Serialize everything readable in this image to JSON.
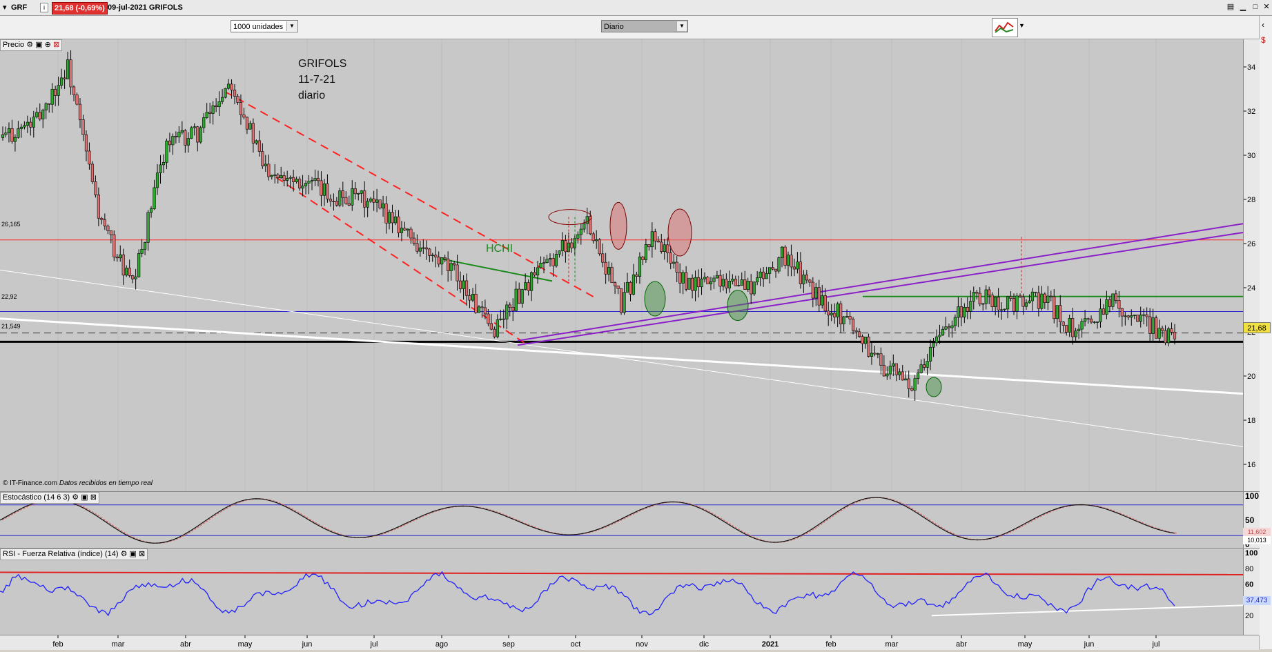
{
  "header": {
    "symbol": "GRF",
    "info_icon": "i",
    "price_change": "21,68 (-0,69%)",
    "date_name": "09-jul-2021 GRIFOLS"
  },
  "toolbar": {
    "units_select": "1000 unidades",
    "period_select": "Diario"
  },
  "panels": {
    "price_title": "Precio",
    "stoch_title": "Estocástico (14 6 3)",
    "rsi_title": "RSI - Fuerza Relativa (índice) (14)",
    "copyright": "© IT-Finance.com",
    "realtime": "Datos recibidos en tiempo real"
  },
  "annotations": {
    "title_lines": [
      "GRIFOLS",
      "11-7-21",
      "diario"
    ],
    "hchi": "HCHI"
  },
  "level_labels": {
    "l1": "26,165",
    "l2": "22,92",
    "l3": "21,549"
  },
  "price_axis": {
    "ticks": [
      "34",
      "32",
      "30",
      "28",
      "26",
      "24",
      "22",
      "20",
      "18",
      "16"
    ],
    "current": "21,68"
  },
  "stoch_axis": {
    "ticks": [
      "100",
      "50",
      "0"
    ],
    "k_value": "11,602",
    "d_value": "10,013"
  },
  "rsi_axis": {
    "ticks": [
      "100",
      "80",
      "60",
      "40",
      "20"
    ],
    "current": "37,473"
  },
  "x_axis": {
    "ticks": [
      "feb",
      "mar",
      "abr",
      "may",
      "jun",
      "jul",
      "ago",
      "sep",
      "oct",
      "nov",
      "dic",
      "2021",
      "feb",
      "mar",
      "abr",
      "may",
      "jun",
      "jul"
    ]
  },
  "colors": {
    "up_candle": "#2fa82f",
    "down_candle": "#e07070",
    "bg": "#c8c8c8",
    "resistance": "#ff2020",
    "purple": "#8a1fc8",
    "green_line": "#1a8a1a",
    "rsi_line": "#2020ff"
  },
  "chart_data": [
    {
      "type": "candlestick",
      "title": "GRIFOLS",
      "ylim": [
        15,
        35
      ],
      "close_path": [
        [
          "feb",
          30.8
        ],
        [
          "feb-mid",
          31.5
        ],
        [
          "mar",
          34.0
        ],
        [
          "mar-mid",
          27.0
        ],
        [
          "mar-end",
          24.0
        ],
        [
          "abr",
          30.5
        ],
        [
          "abr-mid",
          31.0
        ],
        [
          "may",
          33.5
        ],
        [
          "may-mid",
          29.5
        ],
        [
          "jun",
          29.0
        ],
        [
          "jun-mid",
          28.2
        ],
        [
          "jul",
          28.0
        ],
        [
          "jul-mid",
          27.2
        ],
        [
          "ago",
          25.5
        ],
        [
          "ago-mid",
          24.5
        ],
        [
          "sep",
          22.0
        ],
        [
          "sep-mid",
          24.0
        ],
        [
          "oct",
          25.5
        ],
        [
          "oct-mid",
          27.0
        ],
        [
          "nov",
          23.2
        ],
        [
          "nov-mid",
          26.5
        ],
        [
          "dic",
          24.0
        ],
        [
          "dic-mid",
          24.5
        ],
        [
          "2021",
          24.0
        ],
        [
          "ene-end",
          25.5
        ],
        [
          "feb",
          23.6
        ],
        [
          "feb-mid",
          22.5
        ],
        [
          "mar",
          20.5
        ],
        [
          "mar-mid",
          19.5
        ],
        [
          "abr",
          22.5
        ],
        [
          "abr-mid",
          23.6
        ],
        [
          "may",
          23.2
        ],
        [
          "may-mid",
          23.5
        ],
        [
          "jun",
          21.8
        ],
        [
          "jun-mid",
          23.5
        ],
        [
          "jul",
          22.5
        ],
        [
          "jul-mid",
          21.68
        ]
      ],
      "horizontal_levels": [
        26.165,
        22.92,
        21.549
      ],
      "last": 21.68
    },
    {
      "type": "line",
      "title": "Estocástico (14 6 3)",
      "ylim": [
        0,
        100
      ],
      "last_k": 11.602,
      "last_d": 10.013
    },
    {
      "type": "line",
      "title": "RSI - Fuerza Relativa (índice) (14)",
      "ylim": [
        0,
        100
      ],
      "last": 37.473
    }
  ]
}
